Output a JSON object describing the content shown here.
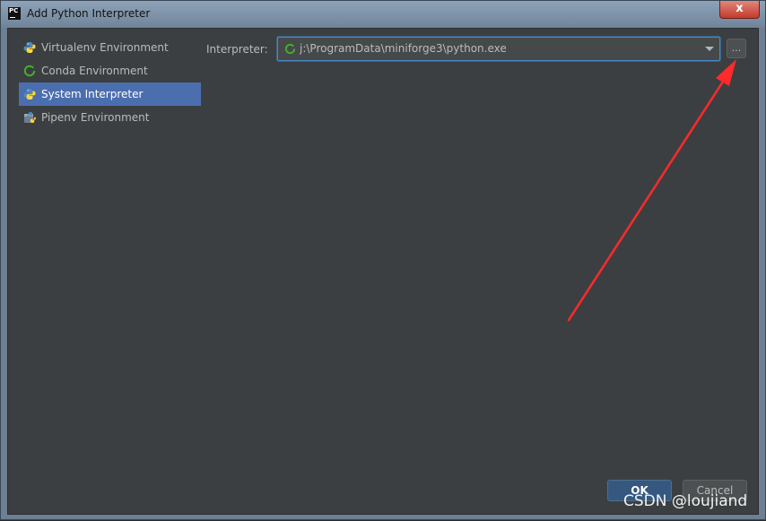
{
  "window": {
    "title": "Add Python Interpreter",
    "logo_text": "PC",
    "close_label": "x"
  },
  "sidebar": {
    "items": [
      {
        "label": "Virtualenv Environment",
        "icon": "python-icon",
        "selected": false
      },
      {
        "label": "Conda Environment",
        "icon": "conda-icon",
        "selected": false
      },
      {
        "label": "System Interpreter",
        "icon": "python-icon",
        "selected": true
      },
      {
        "label": "Pipenv Environment",
        "icon": "pipenv-icon",
        "selected": false
      }
    ]
  },
  "interpreter": {
    "label": "Interpreter:",
    "value": "j:\\ProgramData\\miniforge3\\python.exe",
    "browse_label": "..."
  },
  "buttons": {
    "ok": "OK",
    "cancel": "Cancel"
  },
  "watermark": "CSDN @loujiand",
  "colors": {
    "background": "#3c3f41",
    "selection": "#4b6eaf",
    "focus": "#4a88c7",
    "annotation": "#ff2a2a"
  }
}
